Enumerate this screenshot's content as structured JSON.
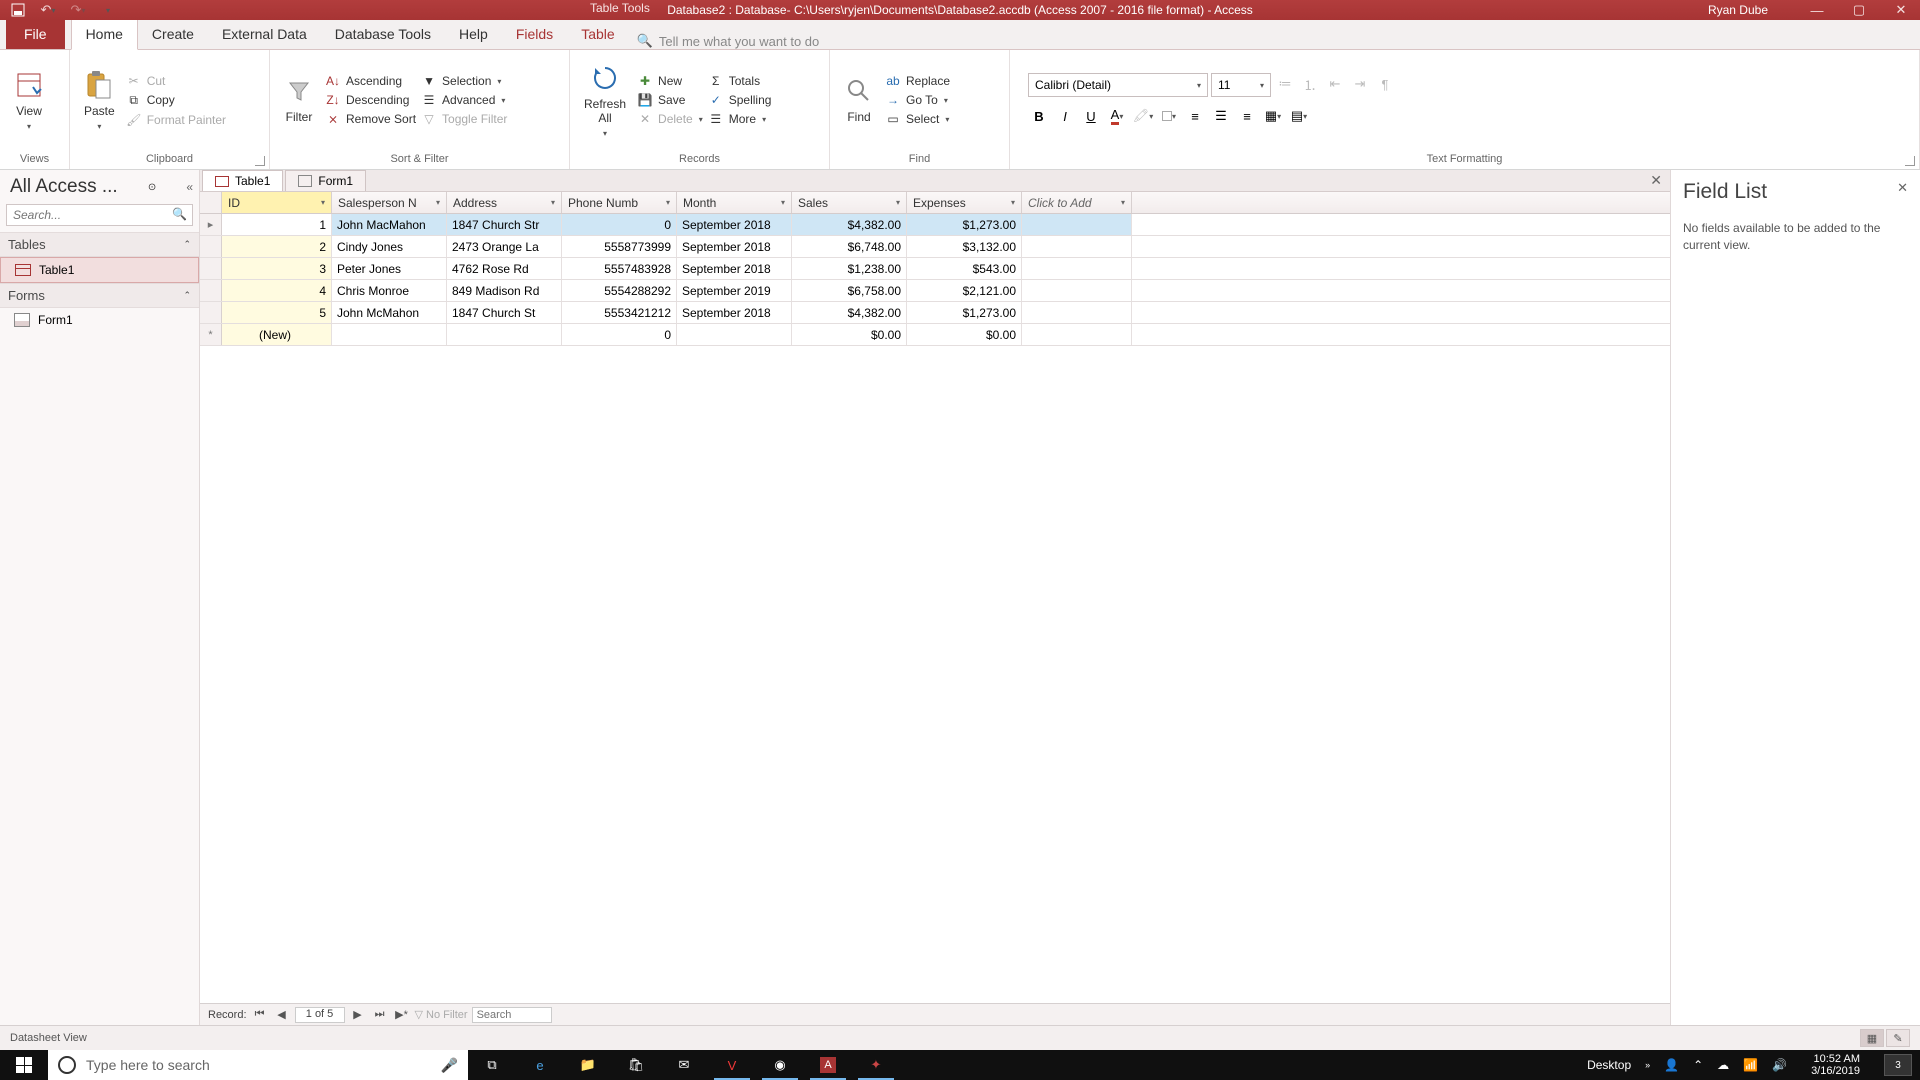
{
  "title_bar": {
    "table_tools": "Table Tools",
    "title": "Database2 : Database- C:\\Users\\ryjen\\Documents\\Database2.accdb (Access 2007 - 2016 file format)  -  Access",
    "user": "Ryan Dube"
  },
  "tabs": {
    "file": "File",
    "home": "Home",
    "create": "Create",
    "external_data": "External Data",
    "database_tools": "Database Tools",
    "help": "Help",
    "fields": "Fields",
    "table": "Table",
    "tellme": "Tell me what you want to do"
  },
  "ribbon": {
    "views": {
      "view": "View",
      "group": "Views"
    },
    "clipboard": {
      "paste": "Paste",
      "cut": "Cut",
      "copy": "Copy",
      "format_painter": "Format Painter",
      "group": "Clipboard"
    },
    "sortfilter": {
      "filter": "Filter",
      "asc": "Ascending",
      "desc": "Descending",
      "remove": "Remove Sort",
      "selection": "Selection",
      "advanced": "Advanced",
      "toggle": "Toggle Filter",
      "group": "Sort & Filter"
    },
    "records": {
      "refresh": "Refresh\nAll",
      "new": "New",
      "save": "Save",
      "delete": "Delete",
      "totals": "Totals",
      "spelling": "Spelling",
      "more": "More",
      "group": "Records"
    },
    "find": {
      "find": "Find",
      "replace": "Replace",
      "goto": "Go To",
      "select": "Select",
      "group": "Find"
    },
    "textfmt": {
      "font_name": "Calibri (Detail)",
      "font_size": "11",
      "group": "Text Formatting"
    }
  },
  "nav": {
    "header": "All Access ...",
    "search_ph": "Search...",
    "tables": "Tables",
    "forms": "Forms",
    "table1": "Table1",
    "form1": "Form1"
  },
  "doc_tabs": {
    "table1": "Table1",
    "form1": "Form1"
  },
  "columns": {
    "id": "ID",
    "salesperson": "Salesperson N",
    "address": "Address",
    "phone": "Phone Numb",
    "month": "Month",
    "sales": "Sales",
    "expenses": "Expenses",
    "click_add": "Click to Add"
  },
  "rows": [
    {
      "id": "1",
      "sp": "John MacMahon",
      "addr": "1847 Church Str",
      "phone": "0",
      "month": "September 2018",
      "sales": "$4,382.00",
      "exp": "$1,273.00"
    },
    {
      "id": "2",
      "sp": "Cindy Jones",
      "addr": "2473 Orange La",
      "phone": "5558773999",
      "month": "September 2018",
      "sales": "$6,748.00",
      "exp": "$3,132.00"
    },
    {
      "id": "3",
      "sp": "Peter Jones",
      "addr": "4762 Rose Rd",
      "phone": "5557483928",
      "month": "September 2018",
      "sales": "$1,238.00",
      "exp": "$543.00"
    },
    {
      "id": "4",
      "sp": "Chris Monroe",
      "addr": "849 Madison Rd",
      "phone": "5554288292",
      "month": "September 2019",
      "sales": "$6,758.00",
      "exp": "$2,121.00"
    },
    {
      "id": "5",
      "sp": "John McMahon",
      "addr": "1847 Church St",
      "phone": "5553421212",
      "month": "September 2018",
      "sales": "$4,382.00",
      "exp": "$1,273.00"
    }
  ],
  "new_row": {
    "id": "(New)",
    "phone": "0",
    "sales": "$0.00",
    "exp": "$0.00"
  },
  "record_nav": {
    "label": "Record:",
    "pos": "1 of 5",
    "no_filter": "No Filter",
    "search": "Search"
  },
  "field_list": {
    "title": "Field List",
    "msg": "No fields available to be added to the current view."
  },
  "status": {
    "view": "Datasheet View"
  },
  "taskbar": {
    "search_ph": "Type here to search",
    "desktop": "Desktop",
    "time": "10:52 AM",
    "date": "3/16/2019",
    "notif": "3"
  }
}
